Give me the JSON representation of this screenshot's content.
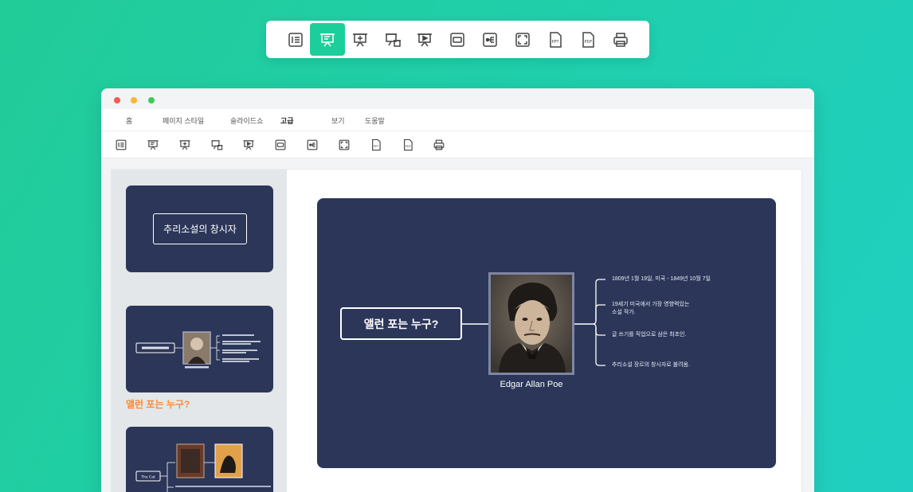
{
  "menu": {
    "items": [
      "홈",
      "페이지 스타일",
      "슬라이드쇼",
      "고급",
      "보기",
      "도움말"
    ],
    "active": "고급"
  },
  "toolbar_icons": [
    "outline-icon",
    "slideshow-icon",
    "add-slide-icon",
    "delete-slide-icon",
    "play-icon",
    "fit-icon",
    "layout-icon",
    "fullscreen-icon",
    "ppt-export-icon",
    "pdf-export-icon",
    "print-icon"
  ],
  "toolbar_icon_labels": {
    "ppt": "PPT",
    "pdf": "PDF"
  },
  "slides": [
    {
      "title": "추리소설의 창시자"
    },
    {
      "caption": "앨런 포는 누구?"
    },
    {
      "topic": "The Cat"
    }
  ],
  "main_slide": {
    "central_topic": "앨런 포는 누구?",
    "person_name": "Edgar Allan Poe",
    "branches": [
      "1809년 1월 19일, 미국 - 1849년 10월 7일",
      "19세기 미국에서 가장 영향력있는\n소설 작가.",
      "글 쓰기를 직업으로 삼은 최초인.",
      "추리소설 장르의 창시자로 불려옴."
    ]
  },
  "colors": {
    "accent": "#1ccf9a",
    "slide_bg": "#2c3659",
    "caption": "#f68b3c",
    "dot_red": "#f25c54",
    "dot_yellow": "#f7b731",
    "dot_green": "#3fc95b"
  }
}
